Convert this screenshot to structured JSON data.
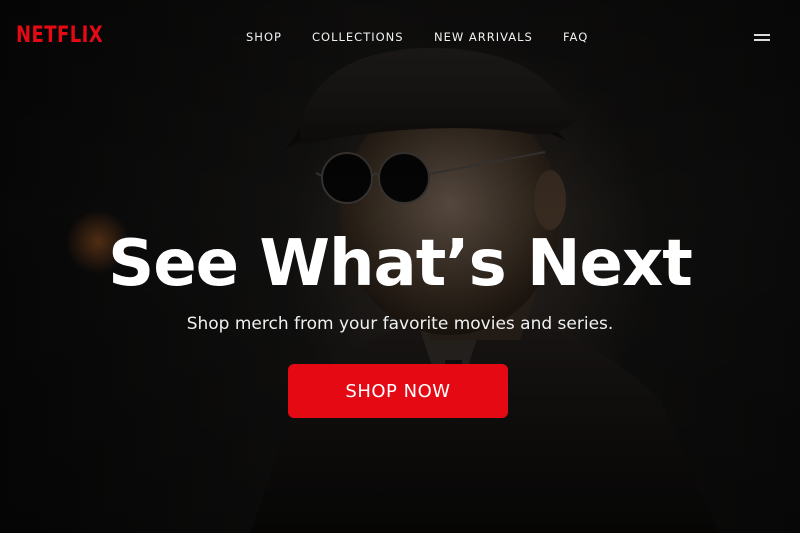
{
  "brand": {
    "logo_text": "NETFLIX",
    "accent_color": "#E50914"
  },
  "nav": {
    "links": [
      {
        "label": "SHOP"
      },
      {
        "label": "COLLECTIONS"
      },
      {
        "label": "NEW ARRIVALS"
      },
      {
        "label": "FAQ"
      }
    ],
    "menu_icon": "hamburger-menu-icon"
  },
  "hero": {
    "headline": "See What’s Next",
    "subtext": "Shop merch from your favorite movies and series.",
    "cta_label": "SHOP NOW",
    "background": "man-in-flat-cap-and-round-sunglasses-photo"
  }
}
